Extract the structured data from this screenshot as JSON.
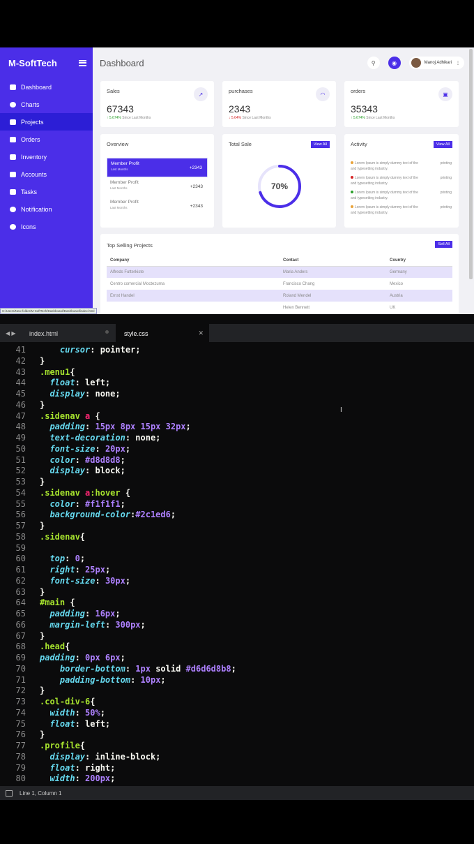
{
  "brand": "M-SoftTech",
  "nav": [
    {
      "label": "Dashboard",
      "icon": "gauge-icon"
    },
    {
      "label": "Charts",
      "icon": "pie-chart-icon"
    },
    {
      "label": "Projects",
      "icon": "list-icon",
      "active": true
    },
    {
      "label": "Orders",
      "icon": "cart-icon"
    },
    {
      "label": "Inventory",
      "icon": "box-icon"
    },
    {
      "label": "Accounts",
      "icon": "user-icon"
    },
    {
      "label": "Tasks",
      "icon": "tasks-icon"
    },
    {
      "label": "Notification",
      "icon": "bell-icon"
    },
    {
      "label": "Icons",
      "icon": "circle-icon"
    }
  ],
  "topbar": {
    "title": "Dashboard",
    "user_name": "Manoj Adhikari"
  },
  "stats": [
    {
      "label": "Sales",
      "value": "67343",
      "change": "↑ 5.674%",
      "since": "Since Last Months",
      "icon": "trend-icon",
      "color": "#2ca02c"
    },
    {
      "label": "purchases",
      "value": "2343",
      "change": "↓ 5.64%",
      "since": "Since Last Months",
      "icon": "spinner-icon",
      "color": "#d62728"
    },
    {
      "label": "orders",
      "value": "35343",
      "change": "↑ 5.674%",
      "since": "Since Last Months",
      "icon": "bag-icon",
      "color": "#2ca02c"
    }
  ],
  "overview": {
    "title": "Overview",
    "items": [
      {
        "label": "Member Profit",
        "sub": "Last Months",
        "value": "+2343"
      },
      {
        "label": "Member Profit",
        "sub": "Last Months",
        "value": "+2343"
      },
      {
        "label": "Member Profit",
        "sub": "Last Months",
        "value": "+2343"
      }
    ]
  },
  "total_sale": {
    "title": "Total Sale",
    "view_all": "View All",
    "percent": "70%",
    "fraction": 0.7
  },
  "activity": {
    "title": "Activity",
    "view_all": "View All",
    "items": [
      {
        "text": "Lorem Ipsum is simply dummy text of the",
        "text2": "and typesetting industry.",
        "tag": "printing",
        "dot": "#e8a33a"
      },
      {
        "text": "Lorem Ipsum is simply dummy text of the",
        "text2": "and typesetting industry.",
        "tag": "printing",
        "dot": "#d62728"
      },
      {
        "text": "Lorem Ipsum is simply dummy text of the",
        "text2": "and typesetting industry.",
        "tag": "printing",
        "dot": "#2ca02c"
      },
      {
        "text": "Lorem Ipsum is simply dummy text of the",
        "text2": "and typesetting industry.",
        "tag": "printing",
        "dot": "#e8a33a"
      }
    ]
  },
  "projects": {
    "title": "Top Selling Projects",
    "sell_all": "Sell All",
    "headers": [
      "Company",
      "Contact",
      "Country"
    ],
    "rows": [
      [
        "Alfreds Futterkiste",
        "Maria Anders",
        "Germany"
      ],
      [
        "Centro comercial Moctezuma",
        "Francisco Chang",
        "Mexico"
      ],
      [
        "Ernst Handel",
        "Roland Mendel",
        "Austria"
      ],
      [
        "",
        "Helen Bennett",
        "UK"
      ]
    ]
  },
  "status_url": "C:/Users/New folder/M-SoftTech/Dashboard/Dashboard/index.html",
  "editor": {
    "tabs": [
      {
        "label": "index.html"
      },
      {
        "label": "style.css",
        "active": true
      }
    ],
    "lines": [
      {
        "n": "41",
        "html": "    <span class=\"prop\">cursor</span>: pointer;"
      },
      {
        "n": "42",
        "html": "}"
      },
      {
        "n": "43",
        "html": "<span class=\"sel-c\">.menu1</span>{"
      },
      {
        "n": "44",
        "html": "  <span class=\"prop\">float</span>: left;"
      },
      {
        "n": "45",
        "html": "  <span class=\"prop\">display</span>: none;"
      },
      {
        "n": "46",
        "html": "}"
      },
      {
        "n": "47",
        "html": "<span class=\"sel-c\">.sidenav</span> <span class=\"tagc\">a</span> {"
      },
      {
        "n": "48",
        "html": "  <span class=\"prop\">padding</span>: <span class=\"val\">15px 8px 15px 32px</span>;"
      },
      {
        "n": "49",
        "html": "  <span class=\"prop\">text-decoration</span>: none;"
      },
      {
        "n": "50",
        "html": "  <span class=\"prop\">font-size</span>: <span class=\"val\">20px</span>;"
      },
      {
        "n": "51",
        "html": "  <span class=\"prop\">color</span>: <span class=\"val\">#d8d8d8</span>;"
      },
      {
        "n": "52",
        "html": "  <span class=\"prop\">display</span>: block;"
      },
      {
        "n": "53",
        "html": "}"
      },
      {
        "n": "54",
        "html": "<span class=\"sel-c\">.sidenav</span> <span class=\"tagc\">a</span><span class=\"sel-c\">:hover</span> {"
      },
      {
        "n": "55",
        "html": "  <span class=\"prop\">color</span>: <span class=\"val\">#f1f1f1</span>;"
      },
      {
        "n": "56",
        "html": "  <span class=\"prop\">background-color</span>:<span class=\"val\">#2c1ed6</span>;"
      },
      {
        "n": "57",
        "html": "}"
      },
      {
        "n": "58",
        "html": "<span class=\"sel-c\">.sidenav</span>{"
      },
      {
        "n": "59",
        "html": ""
      },
      {
        "n": "60",
        "html": "  <span class=\"prop\">top</span>: <span class=\"val\">0</span>;"
      },
      {
        "n": "61",
        "html": "  <span class=\"prop\">right</span>: <span class=\"val\">25px</span>;"
      },
      {
        "n": "62",
        "html": "  <span class=\"prop\">font-size</span>: <span class=\"val\">30px</span>;"
      },
      {
        "n": "63",
        "html": "}"
      },
      {
        "n": "64",
        "html": "<span class=\"sel-c\">#main</span> {"
      },
      {
        "n": "65",
        "html": "  <span class=\"prop\">padding</span>: <span class=\"val\">16px</span>;"
      },
      {
        "n": "66",
        "html": "  <span class=\"prop\">margin-left</span>: <span class=\"val\">300px</span>;"
      },
      {
        "n": "67",
        "html": "}"
      },
      {
        "n": "68",
        "html": "<span class=\"sel-c\">.head</span>{"
      },
      {
        "n": "69",
        "html": "<span class=\"prop\">padding</span>: <span class=\"val\">0px 6px</span>;"
      },
      {
        "n": "70",
        "html": "    <span class=\"prop\">border-bottom</span>: <span class=\"val\">1px</span> solid <span class=\"val\">#d6d6d8b8</span>;"
      },
      {
        "n": "71",
        "html": "    <span class=\"prop\">padding-bottom</span>: <span class=\"val\">10px</span>;"
      },
      {
        "n": "72",
        "html": "}"
      },
      {
        "n": "73",
        "html": "<span class=\"sel-c\">.col-div-6</span>{"
      },
      {
        "n": "74",
        "html": "  <span class=\"prop\">width</span>: <span class=\"val\">50%</span>;"
      },
      {
        "n": "75",
        "html": "  <span class=\"prop\">float</span>: left;"
      },
      {
        "n": "76",
        "html": "}"
      },
      {
        "n": "77",
        "html": "<span class=\"sel-c\">.profile</span>{"
      },
      {
        "n": "78",
        "html": "  <span class=\"prop\">display</span>: inline-block;"
      },
      {
        "n": "79",
        "html": "  <span class=\"prop\">float</span>: right;"
      },
      {
        "n": "80",
        "html": "  <span class=\"prop\">width</span>: <span class=\"val\">200px</span>;"
      }
    ],
    "status": "Line 1, Column 1"
  }
}
